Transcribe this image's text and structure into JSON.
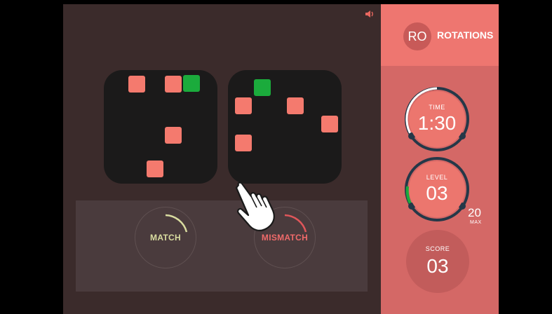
{
  "header": {
    "badge": "RO",
    "title": "ROTATIONS"
  },
  "stats": {
    "time_label": "TIME",
    "time_value": "1:30",
    "level_label": "LEVEL",
    "level_value": "03",
    "max_value": "20",
    "max_label": "MAX",
    "score_label": "SCORE",
    "score_value": "03"
  },
  "buttons": {
    "match": "MATCH",
    "mismatch": "MISMATCH"
  },
  "colors": {
    "red_cell": "#f47a6e",
    "green_cell": "#1bab3c",
    "board": "#1b1a1a",
    "sidebar": "#d46866",
    "dial_ring": "#263a4c"
  },
  "icons": {
    "sound": "speaker-icon",
    "pointer": "hand-pointer-icon"
  }
}
